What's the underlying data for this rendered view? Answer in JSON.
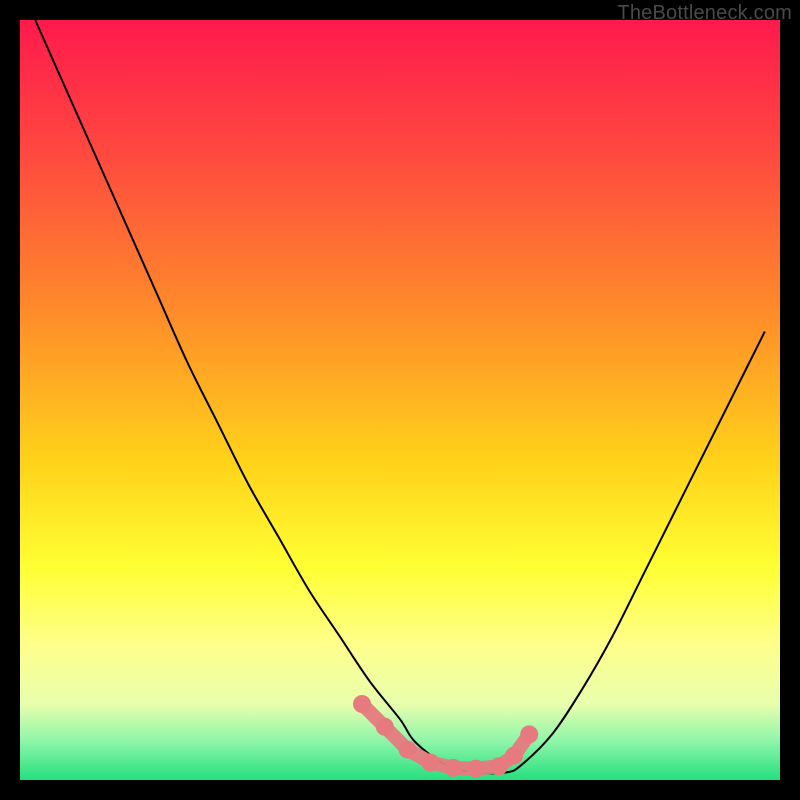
{
  "watermark": "TheBottleneck.com",
  "chart_data": {
    "type": "line",
    "title": "",
    "xlabel": "",
    "ylabel": "",
    "xlim": [
      0,
      100
    ],
    "ylim": [
      0,
      100
    ],
    "series": [
      {
        "name": "bottleneck-curve",
        "x": [
          2,
          6,
          10,
          14,
          18,
          22,
          26,
          30,
          34,
          38,
          42,
          46,
          50,
          52,
          56,
          60,
          64,
          66,
          70,
          74,
          78,
          82,
          86,
          90,
          94,
          98
        ],
        "y": [
          100,
          91,
          82,
          73,
          64,
          55,
          47,
          39,
          32,
          25,
          19,
          13,
          8,
          5,
          2,
          1,
          1,
          2,
          6,
          12,
          19,
          27,
          35,
          43,
          51,
          59
        ]
      }
    ],
    "highlight_points": {
      "name": "highlight-dots",
      "color": "#e77a7f",
      "x": [
        45,
        48,
        51,
        54,
        57,
        60,
        63,
        65,
        67
      ],
      "y": [
        10,
        7,
        4,
        2.3,
        1.6,
        1.5,
        1.8,
        3.2,
        6
      ]
    }
  }
}
